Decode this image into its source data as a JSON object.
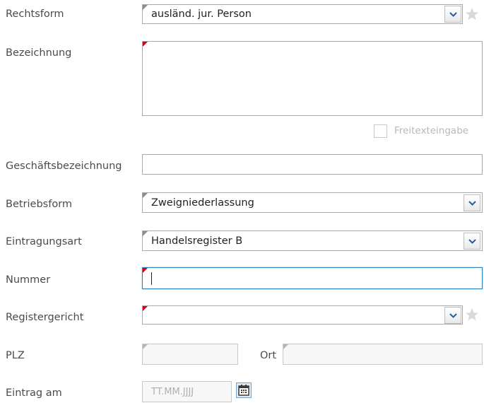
{
  "labels": {
    "rechtsform": "Rechtsform",
    "bezeichnung": "Bezeichnung",
    "geschaeftsbezeichnung": "Geschäftsbezeichnung",
    "betriebsform": "Betriebsform",
    "eintragungsart": "Eintragungsart",
    "nummer": "Nummer",
    "registergericht": "Registergericht",
    "plz": "PLZ",
    "ort": "Ort",
    "eintrag_am": "Eintrag am",
    "freitext": "Freitexteingabe"
  },
  "values": {
    "rechtsform": "ausländ. jur. Person",
    "betriebsform": "Zweigniederlassung",
    "eintragungsart": "Handelsregister B",
    "nummer": "",
    "registergericht": "",
    "plz": "",
    "ort": "",
    "geschaeftsbezeichnung": "",
    "bezeichnung": ""
  },
  "placeholders": {
    "eintrag_am": "TT.MM.JJJJ"
  },
  "icons": {
    "dropdown": "chevron-down-icon",
    "favorite": "star-icon",
    "calendar": "calendar-icon"
  },
  "colors": {
    "required_marker": "#d0021b",
    "focus_border": "#2a7fbf",
    "chevron": "#2a5d8f"
  }
}
